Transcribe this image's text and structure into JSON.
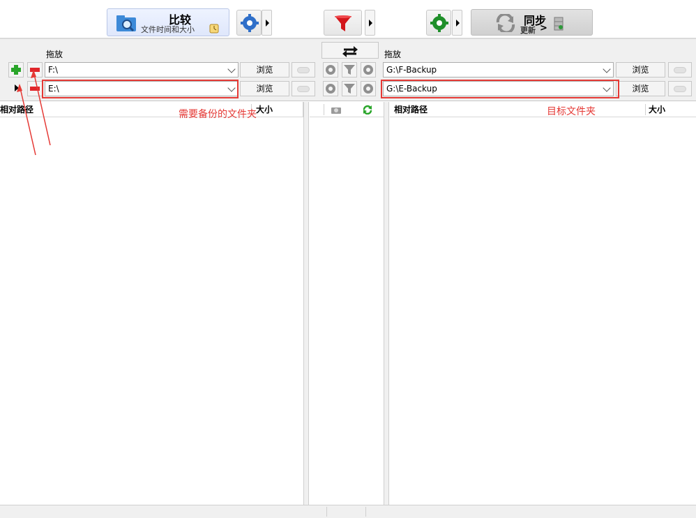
{
  "toolbar": {
    "compare_label": "比较",
    "compare_sub": "文件时间和大小",
    "sync_label": "同步",
    "sync_sub": "更新"
  },
  "left": {
    "drag_label": "拖放",
    "folder_1": "F:\\",
    "folder_2": "E:\\",
    "browse_1": "浏览",
    "browse_2": "浏览",
    "col_path": "相对路径",
    "col_size": "大小",
    "annotation": "需要备份的文件夹"
  },
  "right": {
    "drag_label": "拖放",
    "folder_1": "G:\\F-Backup",
    "folder_2": "G:\\E-Backup",
    "browse_1": "浏览",
    "browse_2": "浏览",
    "col_path": "相对路径",
    "col_size": "大小",
    "annotation": "目标文件夹"
  },
  "colors": {
    "annotation_red": "#e53935",
    "gear_blue": "#2f6fc9",
    "gear_green": "#1f8f2a",
    "filter_red": "#d3161b"
  }
}
